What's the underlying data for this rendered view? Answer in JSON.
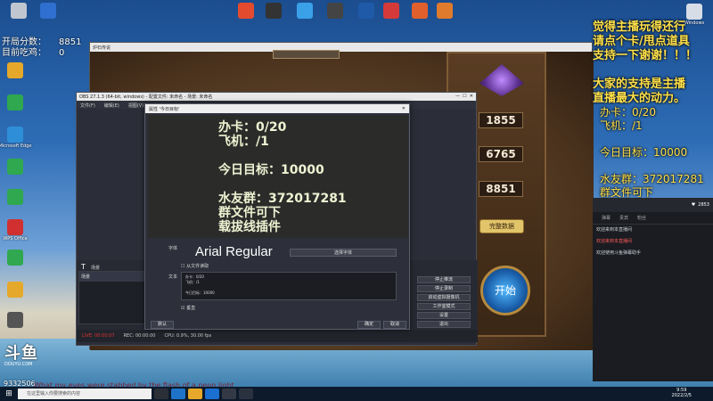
{
  "desktop": {
    "icons_top": [
      {
        "label": "",
        "color": "#bfc6cf"
      },
      {
        "label": "",
        "color": "#2f6fd0"
      },
      {
        "label": "",
        "color": "#e34b2f"
      },
      {
        "label": "",
        "color": "#333333"
      },
      {
        "label": "",
        "color": "#3aa0e8"
      },
      {
        "label": "",
        "color": "#444444"
      },
      {
        "label": "",
        "color": "#1e5aa8"
      },
      {
        "label": "",
        "color": "#d53a3a"
      },
      {
        "label": "",
        "color": "#e0602d"
      },
      {
        "label": "",
        "color": "#e07a2d"
      }
    ],
    "icons_left": [
      {
        "label": "",
        "color": "#e6a82a"
      },
      {
        "label": "",
        "color": "#2fa84f"
      },
      {
        "label": "Microsoft Edge",
        "color": "#2e8fd8"
      },
      {
        "label": "",
        "color": "#2fa84f"
      },
      {
        "label": "",
        "color": "#2fa84f"
      },
      {
        "label": "WPS Office",
        "color": "#d03030"
      },
      {
        "label": "",
        "color": "#2fa84f"
      },
      {
        "label": "",
        "color": "#e6a82a"
      },
      {
        "label": "",
        "color": "#555555"
      }
    ],
    "recycle_label": "Windows"
  },
  "left_overlay": {
    "line1_label": "开局分数：",
    "line1_value": "8851",
    "line2_label": "目前吃鸡：",
    "line2_value": "0"
  },
  "right_overlay": {
    "lines": [
      "觉得主播玩得还行",
      "请点个卡/甩点道具",
      "支持一下谢谢！！！",
      "",
      "大家的支持是主播",
      "直播最大的动力。"
    ],
    "stats": [
      "办卡：0/20",
      "飞机：/1",
      "",
      "今日目标：10000",
      "",
      "水友群：372017281",
      "群文件可下",
      "载拔线插件"
    ]
  },
  "danmaku": {
    "count": "2853",
    "tabs": [
      "弹幕",
      "贵宾",
      "粉丝"
    ],
    "messages": [
      {
        "text": "欢迎来到本直播间",
        "red": false
      },
      {
        "text": "欢迎来到本直播间",
        "red": true
      },
      {
        "text": "欢迎使用斗鱼弹幕助手",
        "red": false
      },
      {
        "text": "",
        "red": false
      }
    ]
  },
  "game": {
    "title": "炉石传说",
    "top_label": "",
    "stats": [
      {
        "label": "",
        "value": "1855"
      },
      {
        "label": "",
        "value": "6765"
      },
      {
        "label": "",
        "value": "8851"
      }
    ],
    "match_label": "完整数据",
    "start_label": "开始"
  },
  "obs": {
    "title": "OBS 27.1.3 (64-bit, windows) - 配置文件: 未命名 - 场景: 未命名",
    "menu": [
      "文件(F)",
      "编辑(E)",
      "视图(V)"
    ],
    "scenes_title": "场景",
    "sources_item": "场景",
    "controls": [
      "停止推流",
      "停止录制",
      "启动虚拟摄像机",
      "工作室模式",
      "设置",
      "退出"
    ],
    "status": {
      "live": "LIVE: 00:00:07",
      "rec": "REC: 00:00:00",
      "cpu": "CPU: 0.9%, 30.00 fps"
    }
  },
  "properties": {
    "title": "属性 '今日目标'",
    "preview_lines": [
      "办卡：0/20",
      "飞机：/1",
      "",
      "今日目标：10000",
      "",
      "水友群：372017281",
      "群文件可下",
      "载拔线插件"
    ],
    "font_label": "字体",
    "font_name": "Arial Regular",
    "select_font": "选择字体",
    "from_file": "从文件读取",
    "text_label": "文本",
    "text_lines": [
      "办卡：0/20",
      "飞机：/1",
      "",
      "今日目标：10000"
    ],
    "vertical": "垂直",
    "ok": "确定",
    "cancel": "取消",
    "defaults": "默认"
  },
  "bottom": {
    "logo": "斗鱼",
    "logo_sub": "DOUYU.COM",
    "room": "9332506",
    "danmu": "What my eyes were stabbed by the flash of a neon light"
  },
  "taskbar": {
    "search_placeholder": "在这里输入你要搜索的内容",
    "time": "9:59",
    "date": "2022/2/5"
  }
}
